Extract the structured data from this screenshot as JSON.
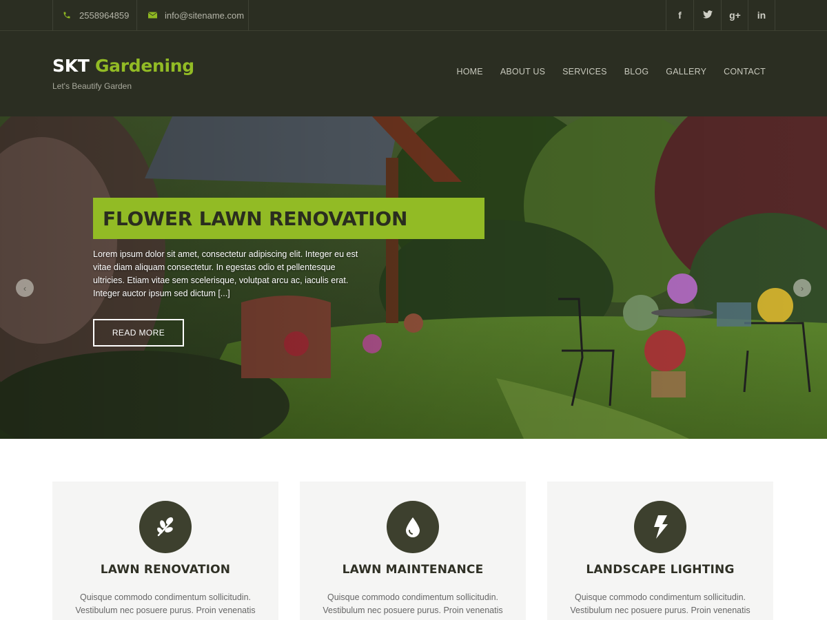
{
  "topbar": {
    "phone": "2558964859",
    "email": "info@sitename.com",
    "social": [
      {
        "glyph": "f",
        "name": "facebook-icon"
      },
      {
        "glyph": "twitter",
        "name": "twitter-icon"
      },
      {
        "glyph": "g+",
        "name": "google-plus-icon"
      },
      {
        "glyph": "in",
        "name": "linkedin-icon"
      }
    ],
    "accent": "#8fb822"
  },
  "header": {
    "logo_part1": "SKT",
    "logo_part2": "Gardening",
    "tagline": "Let's Beautify Garden",
    "nav": [
      "HOME",
      "ABOUT US",
      "SERVICES",
      "BLOG",
      "GALLERY",
      "CONTACT"
    ]
  },
  "hero": {
    "title": "FLOWER LAWN RENOVATION",
    "text": "Lorem ipsum dolor sit amet, consectetur adipiscing elit. Integer eu est vitae diam aliquam consectetur. In egestas odio et pellentesque ultricies. Etiam vitae sem scelerisque, volutpat arcu ac, iaculis erat. Integer auctor ipsum sed dictum [...]",
    "button": "READ MORE",
    "prev_glyph": "‹",
    "next_glyph": "›"
  },
  "services": [
    {
      "icon": "leaf-icon",
      "title": "LAWN RENOVATION",
      "text_line1": "Quisque commodo condimentum sollicitudin.",
      "text_line2": "Vestibulum nec posuere purus. Proin venenatis"
    },
    {
      "icon": "water-drop-icon",
      "title": "LAWN MAINTENANCE",
      "text_line1": "Quisque commodo condimentum sollicitudin.",
      "text_line2": "Vestibulum nec posuere purus. Proin venenatis"
    },
    {
      "icon": "lightning-icon",
      "title": "LANDSCAPE LIGHTING",
      "text_line1": "Quisque commodo condimentum sollicitudin.",
      "text_line2": "Vestibulum nec posuere purus. Proin venenatis"
    }
  ],
  "colors": {
    "dark_bg": "#2b2e22",
    "brand_green": "#92bb25",
    "icon_circle": "#3d402e"
  }
}
